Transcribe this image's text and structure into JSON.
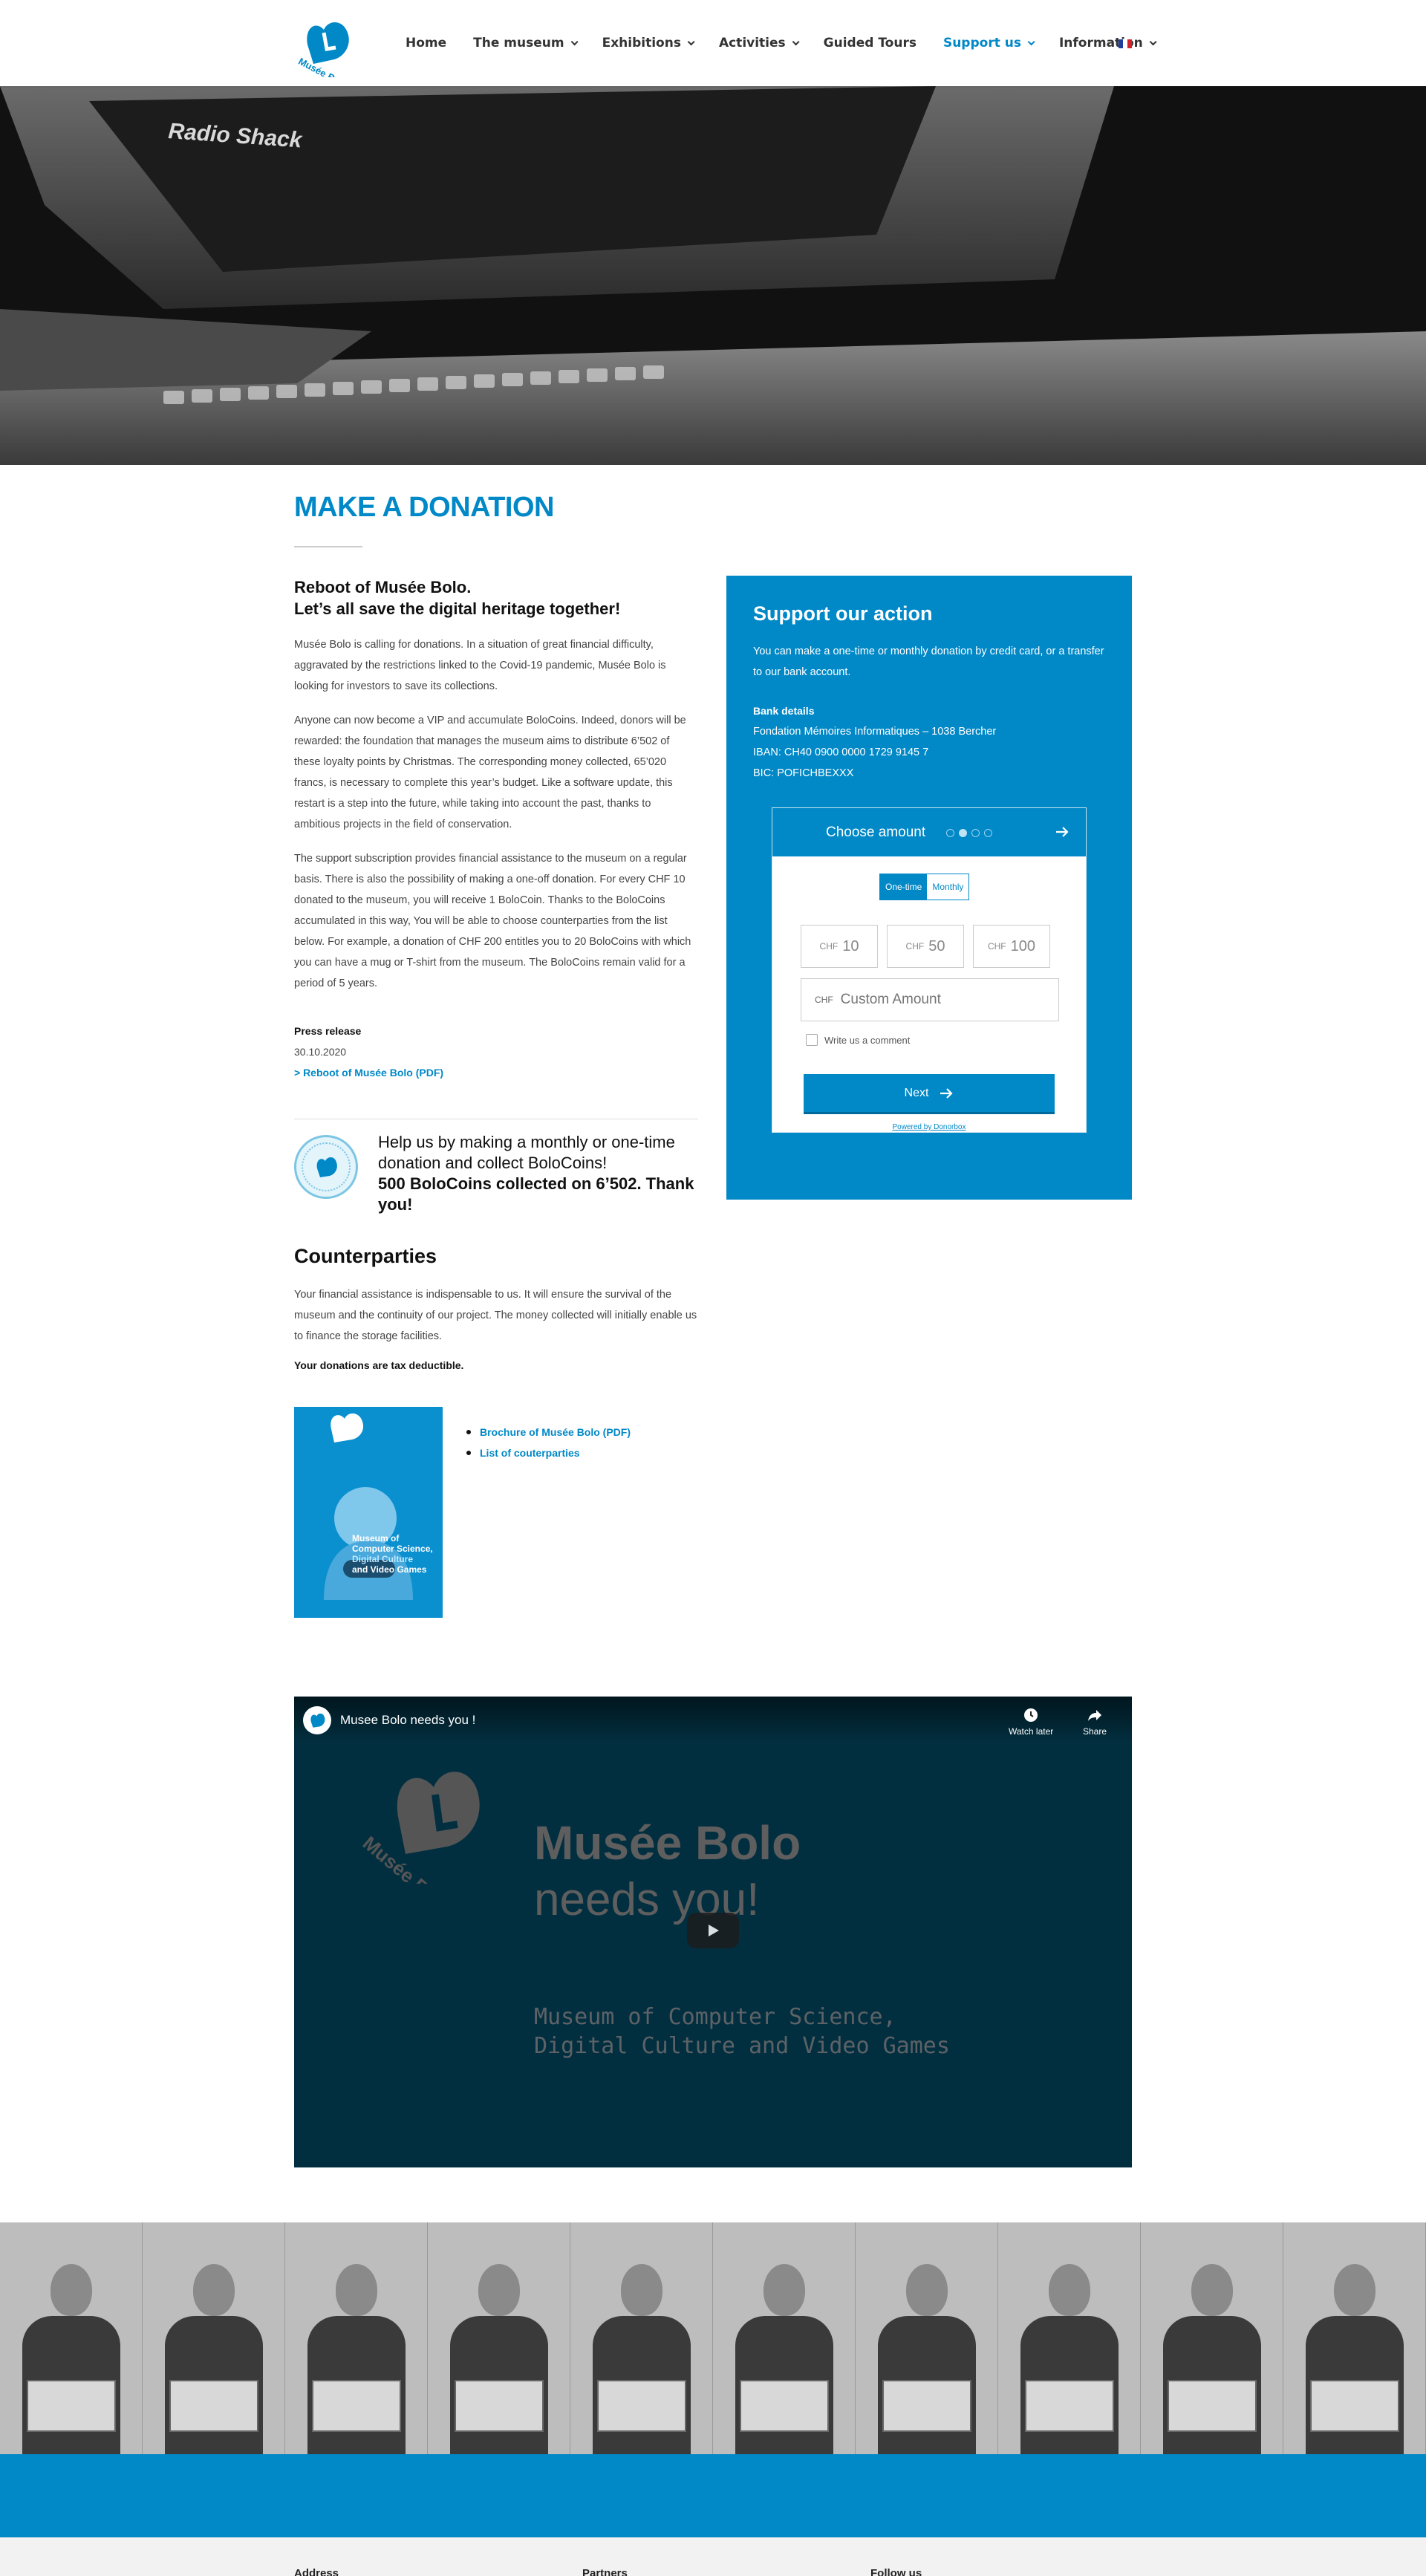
{
  "header": {
    "logo_text": "Musée Bolo",
    "nav": [
      {
        "label": "Home",
        "has_dropdown": false,
        "active": false
      },
      {
        "label": "The museum",
        "has_dropdown": true,
        "active": false
      },
      {
        "label": "Exhibitions",
        "has_dropdown": true,
        "active": false
      },
      {
        "label": "Activities",
        "has_dropdown": true,
        "active": false
      },
      {
        "label": "Guided Tours",
        "has_dropdown": false,
        "active": false
      },
      {
        "label": "Support us",
        "has_dropdown": true,
        "active": true
      },
      {
        "label": "Information",
        "has_dropdown": true,
        "active": false
      }
    ],
    "language_flag": "flag-fr-icon"
  },
  "hero": {
    "brand_text": "Radio Shack"
  },
  "main": {
    "title": "MAKE A DONATION",
    "intro_line1": "Reboot of Musée Bolo.",
    "intro_line2": "Let’s all save the digital heritage together!",
    "paragraphs": [
      "Musée Bolo is calling for donations. In a situation of great financial difficulty, aggravated by the restrictions linked to the Covid-19 pandemic, Musée Bolo is looking for investors to save its collections.",
      "Anyone can now become a VIP and accumulate BoloCoins. Indeed, donors will be rewarded: the foundation that manages the museum aims to distribute 6’502 of these loyalty points by Christmas. The corresponding money collected, 65’020 francs, is necessary to complete this year’s budget. Like a software update, this restart is a step into the future, while taking into account the past, thanks to ambitious projects in the field of conservation.",
      "The support subscription provides financial assistance to the museum on a regular basis. There is also the possibility of making a one-off donation. For every CHF 10 donated to the museum, you will receive 1 BoloCoin. Thanks to the BoloCoins accumulated in this way, You will be able to choose counterparties from the list below. For example, a donation of CHF 200 entitles you to 20 BoloCoins with which you can have a mug or T-shirt from the museum. The BoloCoins remain valid for a period of 5 years."
    ],
    "press_label": "Press release",
    "press_date": "30.10.2020",
    "press_link": "> Reboot of Musée Bolo (PDF)",
    "coins_text": "Help us by making a monthly or one-time donation and collect BoloCoins!",
    "coins_bold": "500 BoloCoins collected on 6’502. Thank you!",
    "counterparties_title": "Counterparties",
    "counterparties_text": "Your financial assistance is indispensable to us. It will ensure the survival of the museum and the continuity of our project. The money collected will initially enable us to finance the storage facilities.",
    "tax_note": "Your donations are tax deductible.",
    "brochure": {
      "logo": "Musée Bolo",
      "line1": "Museum of",
      "line2": "Computer Science,",
      "line3": "Digital Culture",
      "line4": "and Video Games"
    },
    "docs": [
      "Brochure of Musée Bolo (PDF)",
      "List of couterparties"
    ]
  },
  "support": {
    "title": "Support our action",
    "desc": "You can make a one-time or monthly donation by credit card, or a transfer to our bank account.",
    "bank_heading": "Bank details",
    "bank_lines": [
      "Fondation Mémoires Informatiques – 1038 Bercher",
      "IBAN: CH40 0900 0000 1729 9145 7",
      "BIC: POFICHBEXXX"
    ],
    "widget": {
      "header": "Choose amount",
      "steps": 4,
      "current_step": 1,
      "frequency": [
        "One-time",
        "Monthly"
      ],
      "currency": "CHF",
      "amounts": [
        "10",
        "50",
        "100"
      ],
      "custom_placeholder": "Custom Amount",
      "comment_label": "Write us a comment",
      "next_label": "Next",
      "powered_by": "Powered by Donorbox"
    }
  },
  "video": {
    "title": "Musee Bolo needs you !",
    "watch_later": "Watch later",
    "share": "Share",
    "heading1": "Musée Bolo",
    "heading2": "needs you!",
    "sub1": "Museum of Computer Science,",
    "sub2": "Digital Culture and Video Games",
    "watermark": "Musée Bolo"
  },
  "footer": {
    "columns": [
      "Address",
      "Partners",
      "Follow us"
    ]
  },
  "colors": {
    "accent": "#0088c7",
    "text": "#333333"
  }
}
